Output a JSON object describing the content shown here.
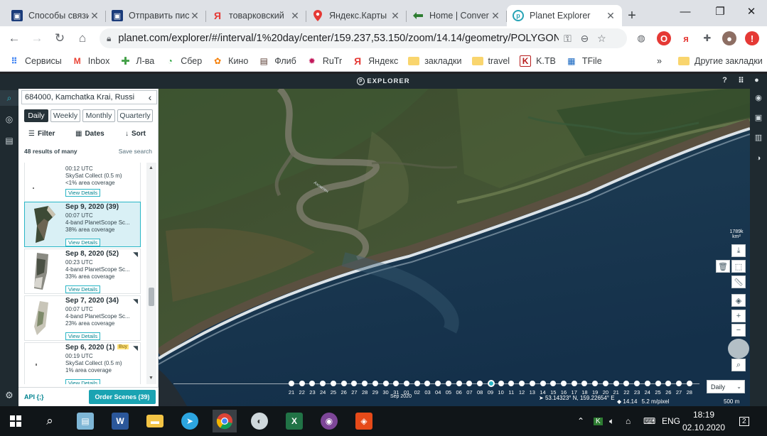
{
  "browser": {
    "tabs": [
      {
        "title": "Способы связи",
        "icon": "planet-favicon",
        "color": "#1a3b7a"
      },
      {
        "title": "Отправить пис",
        "icon": "planet-favicon",
        "color": "#1a3b7a"
      },
      {
        "title": "товарковский",
        "icon": "yandex-favicon",
        "color": "#e53935"
      },
      {
        "title": "Яндекс.Карты",
        "icon": "maps-pin-favicon",
        "color": "#e53935"
      },
      {
        "title": "Home | Conver",
        "icon": "convert-favicon",
        "color": "#2e7d32"
      },
      {
        "title": "Planet Explorer",
        "icon": "planet-explorer-favicon",
        "color": "#26a3b5"
      }
    ],
    "url": "planet.com/explorer/#/interval/1%20day/center/159.237,53.150/zoom/14.14/geometry/POLYGON...",
    "bookmarks": [
      {
        "label": "Сервисы",
        "icon": "apps-grid-icon"
      },
      {
        "label": "Inbox",
        "icon": "gmail-icon"
      },
      {
        "label": "Л-ва",
        "icon": "green-cross-icon"
      },
      {
        "label": "Сбер",
        "icon": "sber-icon"
      },
      {
        "label": "Кино",
        "icon": "kino-icon"
      },
      {
        "label": "Флиб",
        "icon": "flib-icon"
      },
      {
        "label": "RuTr",
        "icon": "rutr-icon"
      },
      {
        "label": "Яндекс",
        "icon": "yandex-icon"
      },
      {
        "label": "закладки",
        "icon": "folder-icon"
      },
      {
        "label": "travel",
        "icon": "folder-icon"
      },
      {
        "label": "K.TB",
        "icon": "ktb-icon"
      },
      {
        "label": "TFile",
        "icon": "tfile-icon"
      }
    ],
    "other_bookmarks": "Другие закладки",
    "more": "»"
  },
  "planet": {
    "brand": "EXPLORER",
    "search_value": "684000, Kamchatka Krai, Russi",
    "intervals": [
      "Daily",
      "Weekly",
      "Monthly",
      "Quarterly"
    ],
    "active_interval": "Daily",
    "filter_label": "Filter",
    "dates_label": "Dates",
    "sort_label": "Sort",
    "results_count": "48 results of many",
    "save_search": "Save search",
    "view_details": "View Details",
    "results": [
      {
        "title": "",
        "time": "00:12 UTC",
        "sensor": "SkySat Collect (0.5 m)",
        "coverage": "<1% area coverage",
        "selected": false
      },
      {
        "title": "Sep 9, 2020 (39)",
        "time": "00:07 UTC",
        "sensor": "4-band PlanetScope Sc...",
        "coverage": "38% area coverage",
        "selected": true
      },
      {
        "title": "Sep 8, 2020 (52)",
        "time": "00:23 UTC",
        "sensor": "4-band PlanetScope Sc...",
        "coverage": "33% area coverage",
        "selected": false
      },
      {
        "title": "Sep 7, 2020 (34)",
        "time": "00:07 UTC",
        "sensor": "4-band PlanetScope Sc...",
        "coverage": "23% area coverage",
        "selected": false
      },
      {
        "title": "Sep 6, 2020 (1)",
        "time": "00:19 UTC",
        "sensor": "SkySat Collect (0.5 m)",
        "coverage": "1% area coverage",
        "selected": false,
        "badge": "Buy"
      }
    ],
    "api_label": "API {;}",
    "order_label": "Order Scenes (39)",
    "area_label": "1789k",
    "area_unit": "km²",
    "timeline_days": [
      "21",
      "22",
      "23",
      "24",
      "25",
      "26",
      "27",
      "28",
      "29",
      "30",
      "31",
      "01",
      "02",
      "03",
      "04",
      "05",
      "06",
      "07",
      "08",
      "09",
      "10",
      "11",
      "12",
      "13",
      "14",
      "15",
      "16",
      "17",
      "18",
      "19",
      "20",
      "21",
      "22",
      "23",
      "24",
      "25",
      "26",
      "27",
      "28"
    ],
    "active_day": "09",
    "timeline_month": "Sep 2020",
    "interval_select": "Daily",
    "coord_lat": "53.14323° N,",
    "coord_lon": "159.22654° E",
    "zoom": "14.14",
    "resolution": "5.2 m/pixel",
    "scale": "500 m",
    "colors": {
      "accent": "#1aa3b2",
      "dark": "#1f2a30",
      "sea": "#1a3a58"
    }
  },
  "taskbar": {
    "apps": [
      "windows-start-icon",
      "search-icon",
      "winrar-icon",
      "word-icon",
      "file-explorer-icon",
      "telegram-icon",
      "chrome-icon",
      "satellite-icon",
      "excel-icon",
      "tor-icon",
      "eye-app-icon"
    ],
    "lang": "ENG",
    "time": "18:19",
    "date": "02.10.2020",
    "notifications": "2"
  }
}
